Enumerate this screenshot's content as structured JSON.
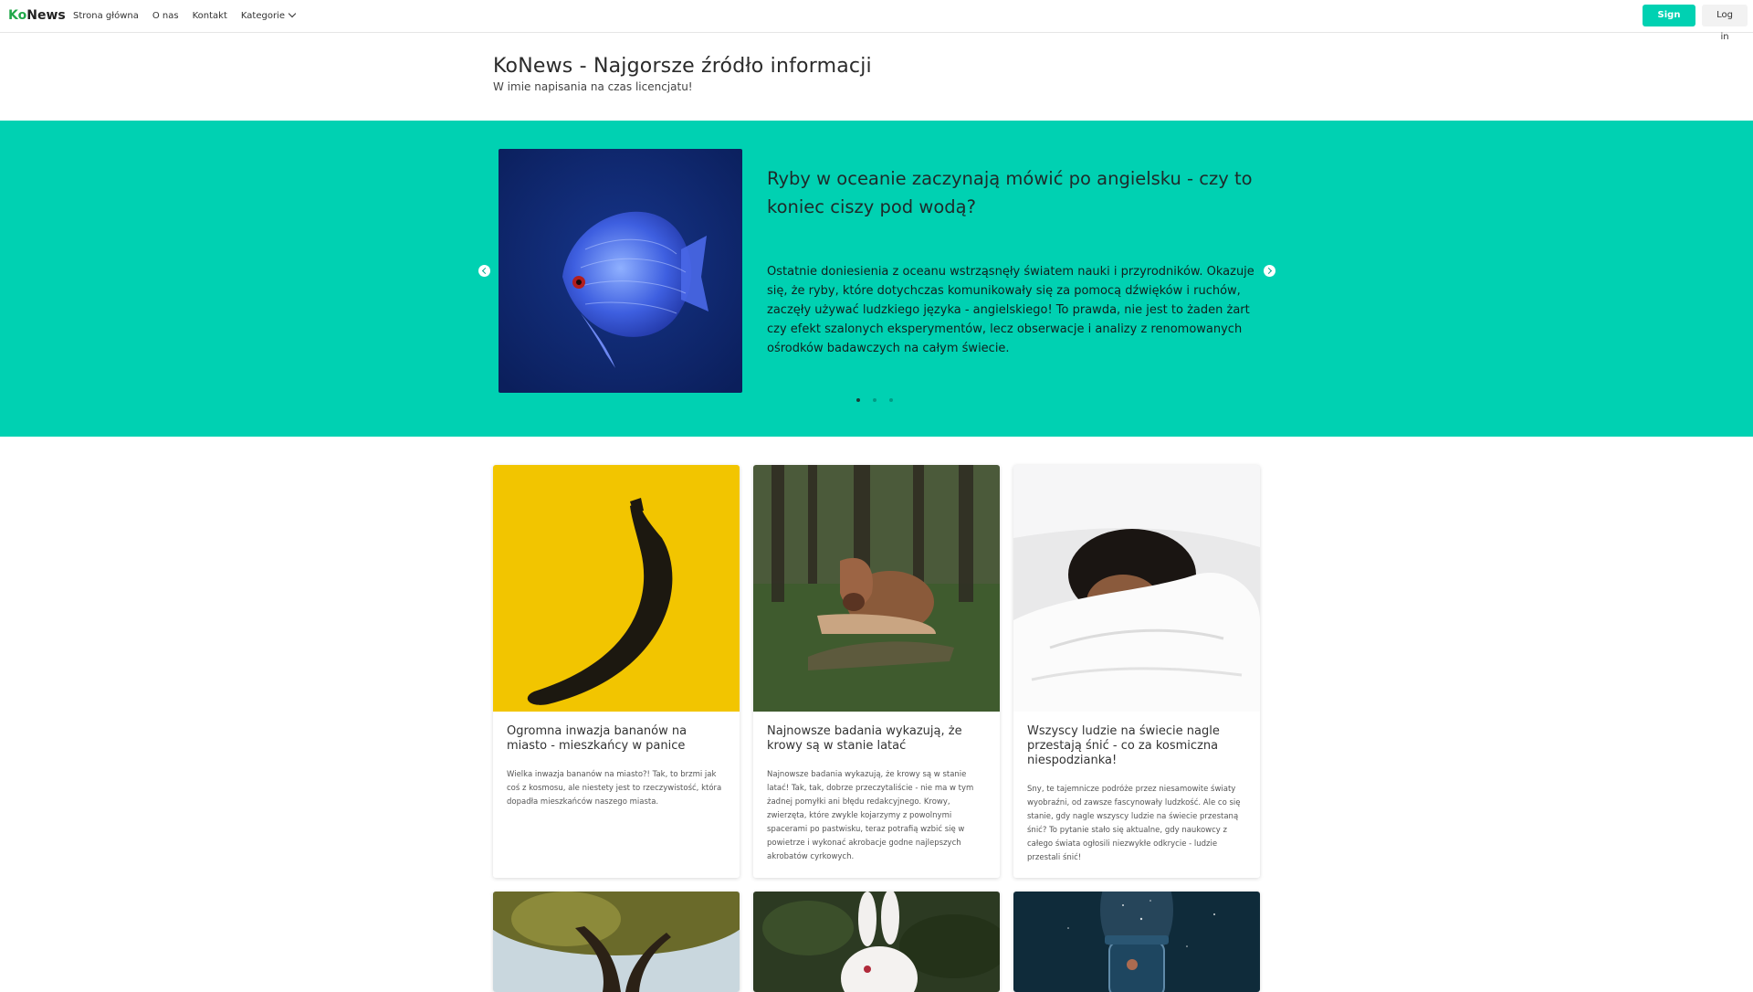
{
  "nav": {
    "brand_prefix": "Ko",
    "brand_suffix": "News",
    "links": [
      "Strona główna",
      "O nas",
      "Kontakt",
      "Kategorie"
    ],
    "signup_label": "Sign up",
    "login_label": "Log in"
  },
  "header": {
    "title": "KoNews - Najgorsze źródło informacji",
    "subtitle": "W imie napisania na czas licencjatu!"
  },
  "hero": {
    "title": "Ryby w oceanie zaczynają mówić po angielsku - czy to koniec ciszy pod wodą?",
    "text": "Ostatnie doniesienia z oceanu wstrząsnęły światem nauki i przyrodników. Okazuje się, że ryby, które dotychczas komunikowały się za pomocą dźwięków i ruchów, zaczęły używać ludzkiego języka - angielskiego! To prawda, nie jest to żaden żart czy efekt szalonych eksperymentów, lecz obserwacje i analizy z renomowanych ośrodków badawczych na całym świecie.",
    "slide_count": 3,
    "active_slide": 1,
    "accent_color": "#00d1b2"
  },
  "cards": [
    {
      "title": "Ogromna inwazja bananów na miasto - mieszkańcy w panice",
      "text": "Wielka inwazja bananów na miasto?! Tak, to brzmi jak coś z kosmosu, ale niestety jest to rzeczywistość, która dopadła mieszkańców naszego miasta."
    },
    {
      "title": "Najnowsze badania wykazują, że krowy są w stanie latać",
      "text": "Najnowsze badania wykazują, że krowy są w stanie latać! Tak, tak, dobrze przeczytaliście - nie ma w tym żadnej pomyłki ani błędu redakcyjnego. Krowy, zwierzęta, które zwykle kojarzymy z powolnymi spacerami po pastwisku, teraz potrafią wzbić się w powietrze i wykonać akrobacje godne najlepszych akrobatów cyrkowych."
    },
    {
      "title": "Wszyscy ludzie na świecie nagle przestają śnić - co za kosmiczna niespodzianka!",
      "text": "Sny, te tajemnicze podróże przez niesamowite światy wyobraźni, od zawsze fascynowały ludzkość. Ale co się stanie, gdy nagle wszyscy ludzie na świecie przestaną śnić? To pytanie stało się aktualne, gdy naukowcy z całego świata ogłosili niezwykłe odkrycie - ludzie przestali śnić!"
    }
  ],
  "colors": {
    "signup": "#00d1b2",
    "brand_green": "#21a84a"
  }
}
